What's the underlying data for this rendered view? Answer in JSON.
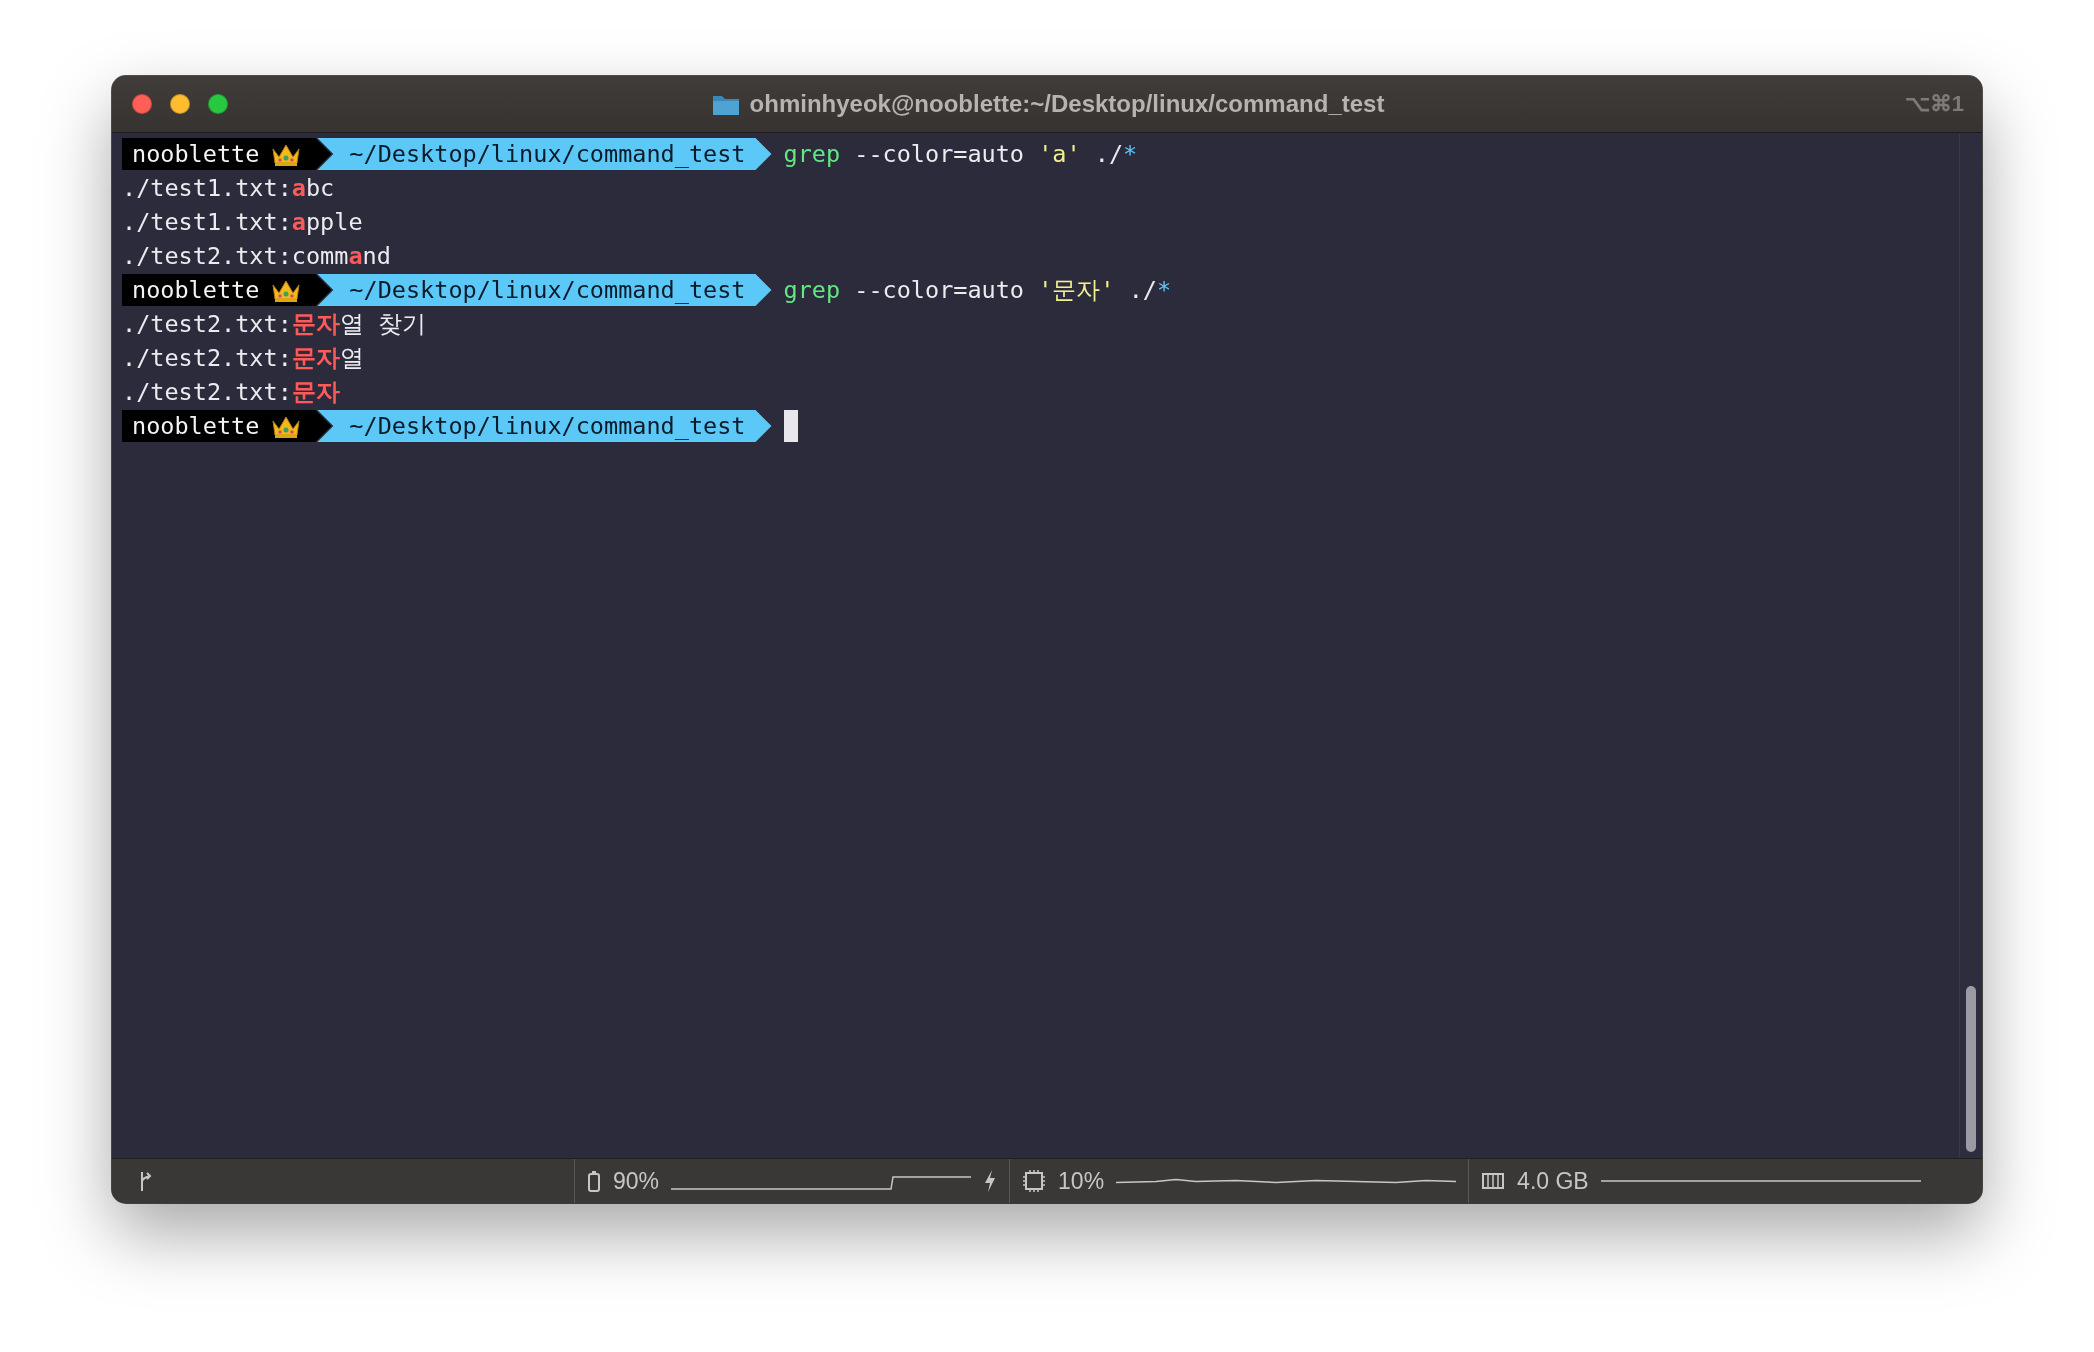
{
  "window": {
    "title": "ohminhyeok@nooblette:~/Desktop/linux/command_test",
    "shortcut": "⌥⌘1"
  },
  "lines": [
    {
      "kind": "prompt",
      "user": "nooblette",
      "path": "~/Desktop/linux/command_test",
      "command": [
        {
          "kind": "program",
          "text": "grep"
        },
        {
          "kind": "option",
          "text": " --color=auto"
        },
        {
          "kind": "string",
          "text": " 'a'"
        },
        {
          "kind": "path",
          "text": " ./"
        },
        {
          "kind": "glob",
          "text": "*"
        }
      ],
      "cursor": false
    },
    {
      "kind": "output",
      "text": "./test1.txt:**a**bc"
    },
    {
      "kind": "output",
      "text": "./test1.txt:**a**pple"
    },
    {
      "kind": "output",
      "text": "./test2.txt:comm**a**nd"
    },
    {
      "kind": "prompt",
      "user": "nooblette",
      "path": "~/Desktop/linux/command_test",
      "command": [
        {
          "kind": "program",
          "text": "grep"
        },
        {
          "kind": "option",
          "text": " --color=auto"
        },
        {
          "kind": "string",
          "text": " '문자'"
        },
        {
          "kind": "path",
          "text": " ./"
        },
        {
          "kind": "glob",
          "text": "*"
        }
      ],
      "cursor": false
    },
    {
      "kind": "output",
      "text": "./test2.txt:**문자**열 찾기"
    },
    {
      "kind": "output",
      "text": "./test2.txt:**문자**열"
    },
    {
      "kind": "output",
      "text": "./test2.txt:**문자**"
    },
    {
      "kind": "prompt",
      "user": "nooblette",
      "path": "~/Desktop/linux/command_test",
      "cursor": true
    }
  ],
  "status_bar": [
    {
      "kind": "battery",
      "value": "90%",
      "charging": true
    },
    {
      "kind": "cpu",
      "value": "10%"
    },
    {
      "kind": "memory",
      "value": "4.0 GB"
    }
  ]
}
